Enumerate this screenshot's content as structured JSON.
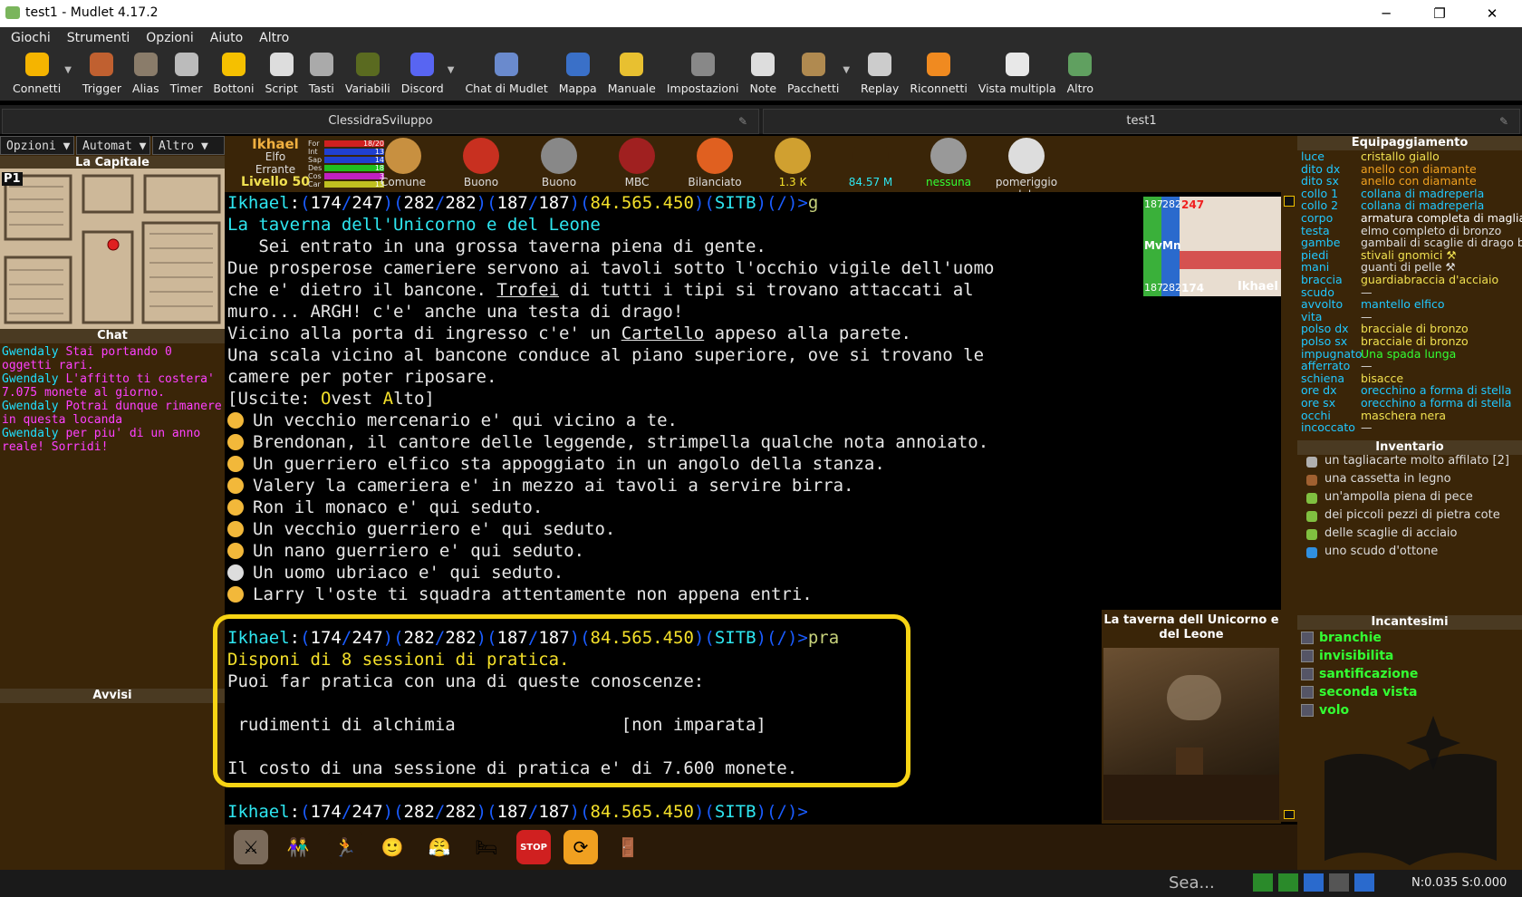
{
  "window": {
    "title": "test1 - Mudlet 4.17.2",
    "min": "─",
    "max": "❐",
    "close": "✕"
  },
  "menu": [
    "Giochi",
    "Strumenti",
    "Opzioni",
    "Aiuto",
    "Altro"
  ],
  "toolbar": [
    {
      "label": "Connetti",
      "icon": "connect-icon",
      "color": "#f5b400",
      "drop": true
    },
    {
      "label": "Trigger",
      "icon": "trigger-icon",
      "color": "#c06030"
    },
    {
      "label": "Alias",
      "icon": "alias-icon",
      "color": "#8a7c6a"
    },
    {
      "label": "Timer",
      "icon": "timer-icon",
      "color": "#bbbbbb"
    },
    {
      "label": "Bottoni",
      "icon": "star-icon",
      "color": "#f5c000"
    },
    {
      "label": "Script",
      "icon": "script-icon",
      "color": "#dddddd"
    },
    {
      "label": "Tasti",
      "icon": "keys-icon",
      "color": "#aaaaaa"
    },
    {
      "label": "Variabili",
      "icon": "variables-icon",
      "color": "#5a6a20"
    },
    {
      "label": "Discord",
      "icon": "discord-icon",
      "color": "#5865f2",
      "drop": true
    },
    {
      "label": "Chat di Mudlet",
      "icon": "chat-icon",
      "color": "#6a8acd"
    },
    {
      "label": "Mappa",
      "icon": "globe-icon",
      "color": "#3a70c8"
    },
    {
      "label": "Manuale",
      "icon": "bulb-icon",
      "color": "#e8c030"
    },
    {
      "label": "Impostazioni",
      "icon": "wrench-icon",
      "color": "#888888"
    },
    {
      "label": "Note",
      "icon": "note-icon",
      "color": "#dddddd"
    },
    {
      "label": "Pacchetti",
      "icon": "package-icon",
      "color": "#b08a50",
      "drop": true
    },
    {
      "label": "Replay",
      "icon": "replay-icon",
      "color": "#cccccc"
    },
    {
      "label": "Riconnetti",
      "icon": "reconnect-icon",
      "color": "#f08a20"
    },
    {
      "label": "Vista multipla",
      "icon": "multiview-icon",
      "color": "#e8e8e8"
    },
    {
      "label": "Altro",
      "icon": "more-icon",
      "color": "#60a060"
    }
  ],
  "tabs": [
    {
      "label": "ClessidraSviluppo",
      "x": "✎"
    },
    {
      "label": "test1",
      "x": "✎"
    }
  ],
  "left": {
    "combos": [
      "Opzioni ▼",
      "Automat ▼",
      "Altro ▼"
    ],
    "map_title": "La Capitale",
    "map_label": "P1",
    "chat_title": "Chat",
    "avvisi_title": "Avvisi",
    "chat": [
      {
        "name": "Gwendaly",
        "text": "Stai portando 0 oggetti rari."
      },
      {
        "name": "Gwendaly",
        "text": "L'affitto ti costera' 7.075 monete al giorno."
      },
      {
        "name": "Gwendaly",
        "text": "Potrai dunque rimanere in questa locanda"
      },
      {
        "name": "Gwendaly",
        "text": "per piu' di un anno reale! Sorridi!"
      }
    ]
  },
  "status": {
    "name": "Ikhael",
    "race": "Elfo",
    "class": "Errante",
    "level": "Livello 50",
    "bars": [
      {
        "l": "For",
        "v": "18/20",
        "c": "#d02020"
      },
      {
        "l": "Int",
        "v": "13",
        "c": "#2040d0"
      },
      {
        "l": "Sap",
        "v": "14",
        "c": "#2040d0"
      },
      {
        "l": "Des",
        "v": "18",
        "c": "#20c020"
      },
      {
        "l": "Cos",
        "v": "3",
        "c": "#c020c0"
      },
      {
        "l": "Car",
        "v": "13",
        "c": "#c0c020"
      }
    ],
    "items": [
      {
        "label": "Comune",
        "icon": "face-icon",
        "c": "#c89040",
        "lc": "#ddd"
      },
      {
        "label": "Buono",
        "icon": "target-icon",
        "c": "#c83020",
        "lc": "#ddd"
      },
      {
        "label": "Buono",
        "icon": "swords-icon",
        "c": "#888",
        "lc": "#ddd"
      },
      {
        "label": "MBC",
        "icon": "shield-icon",
        "c": "#a02020",
        "lc": "#ddd"
      },
      {
        "label": "Bilanciato",
        "icon": "mood-icon",
        "c": "#e06020",
        "lc": "#ddd"
      },
      {
        "label": "1.3 K",
        "icon": "money-icon",
        "c": "#d0a030",
        "lc": "#f4e02a"
      },
      {
        "label": "84.57 M",
        "icon": "stars-icon",
        "c": "#3a2508",
        "lc": "#2ee6f0"
      },
      {
        "label": "nessuna",
        "icon": "castle-icon",
        "c": "#999",
        "lc": "#3f3"
      },
      {
        "label": "pomeriggio del :",
        "icon": "weather-icon",
        "c": "#dddddd",
        "lc": "#ddd"
      }
    ]
  },
  "prompt": {
    "n": "Ikhael",
    "a": "174",
    "b": "247",
    "c": "282",
    "d": "282",
    "e": "187",
    "f": "187",
    "g": "84.565.450",
    "h": "SITB",
    "i": "/"
  },
  "main": {
    "cmd1": "g",
    "room": "La taverna dell'Unicorno e del Leone",
    "desc": [
      "   Sei entrato in una grossa taverna piena di gente.",
      "Due prosperose cameriere servono ai tavoli sotto l'occhio vigile dell'uomo"
    ],
    "d3a": "che e' dietro il bancone. ",
    "d3b": "Trofei",
    "d3c": " di tutti i tipi si trovano attaccati al",
    "d4": "muro... ARGH! c'e' anche una testa di drago!",
    "d5a": "Vicino alla porta di ingresso c'e' un ",
    "d5b": "Cartello",
    "d5c": " appeso alla parete.",
    "d6": "Una scala vicino al bancone conduce al piano superiore, ove si trovano le",
    "d7": "camere per poter riposare.",
    "exits_pre": "[Uscite: ",
    "ex1a": "O",
    "ex1b": "vest ",
    "ex2a": "A",
    "ex2b": "lto",
    "exits_post": "]",
    "npcs": [
      "Un vecchio mercenario e' qui vicino a te.",
      "Brendonan, il cantore delle leggende, strimpella qualche nota annoiato.",
      "Un guerriero elfico sta appoggiato in un angolo della stanza.",
      "Valery la cameriera e' in mezzo ai tavoli a servire birra.",
      "Ron il monaco e' qui seduto.",
      "Un vecchio guerriero e' qui seduto.",
      "Un nano guerriero e' qui seduto.",
      "Un uomo ubriaco e' qui seduto.",
      "Larry l'oste ti squadra attentamente non appena entri."
    ],
    "cmd2": "pra",
    "prac1": "Disponi di 8 sessioni di pratica.",
    "prac2": "Puoi far pratica con una di queste conoscenze:",
    "prac3": " rudimenti di alchimia                [non imparata]",
    "prac4": "Il costo di una sessione di pratica e' di 7.600 monete."
  },
  "portrait": {
    "mv": "Mv",
    "mn": "Mn",
    "v1": "187",
    "v2": "282",
    "v3": "247",
    "v4": "187",
    "v5": "282",
    "v6": "174",
    "name": "Ikhael"
  },
  "room_panel": {
    "title": "La taverna dell Unicorno e del Leone"
  },
  "actions": [
    {
      "icon": "swords-icon",
      "g": "⚔",
      "c": "#7a6a5a"
    },
    {
      "icon": "group-icon",
      "g": "👫",
      "c": "#2a1a08"
    },
    {
      "icon": "run-icon",
      "g": "🏃",
      "c": "#2a1a08"
    },
    {
      "icon": "smile-icon",
      "g": "🙂",
      "c": "#2a1a08"
    },
    {
      "icon": "angry-icon",
      "g": "😤",
      "c": "#2a1a08"
    },
    {
      "icon": "bed-icon",
      "g": "🛏",
      "c": "#2a1a08"
    },
    {
      "icon": "stop-icon",
      "g": "STOP",
      "c": "#d02020"
    },
    {
      "icon": "refresh-icon",
      "g": "⟳",
      "c": "#f0a020"
    },
    {
      "icon": "door-icon",
      "g": "🚪",
      "c": "#2a1a08"
    }
  ],
  "right": {
    "eq_title": "Equipaggiamento",
    "eq": [
      [
        "luce",
        "cristallo giallo",
        "#f0e050"
      ],
      [
        "dito dx",
        "anello con diamante",
        "#f0a020"
      ],
      [
        "dito sx",
        "anello con diamante",
        "#f0a020"
      ],
      [
        "collo 1",
        "collana di madreperla",
        "#20c8ff"
      ],
      [
        "collo 2",
        "collana di madreperla",
        "#20c8ff"
      ],
      [
        "corpo",
        "armatura completa di maglia",
        "#fff"
      ],
      [
        "testa",
        "elmo completo di bronzo",
        "#ddd"
      ],
      [
        "gambe",
        "gambali di scaglie di drago b",
        "#ddd"
      ],
      [
        "piedi",
        "stivali gnomici ⚒",
        "#f0e050"
      ],
      [
        "mani",
        "guanti di pelle ⚒",
        "#ddd"
      ],
      [
        "braccia",
        "guardiabraccia d'acciaio",
        "#f0e050"
      ],
      [
        "scudo",
        "—",
        "#ddd"
      ],
      [
        "avvolto",
        "mantello elfico",
        "#20c8ff"
      ],
      [
        "vita",
        "—",
        "#ddd"
      ],
      [
        "polso dx",
        "bracciale di bronzo",
        "#f0e050"
      ],
      [
        "polso sx",
        "bracciale di bronzo",
        "#f0e050"
      ],
      [
        "impugnato",
        "Una spada lunga",
        "#3f3"
      ],
      [
        "afferrato",
        "—",
        "#ddd"
      ],
      [
        "schiena",
        "bisacce",
        "#f0e050"
      ],
      [
        "ore dx",
        "orecchino a forma di stella",
        "#20c8ff"
      ],
      [
        "ore sx",
        "orecchino a forma di stella",
        "#20c8ff"
      ],
      [
        "occhi",
        "maschera nera",
        "#f0e050"
      ],
      [
        "incoccato",
        "—",
        "#ddd"
      ]
    ],
    "inv_title": "Inventario",
    "inv": [
      [
        "un tagliacarte molto affilato [2]",
        "#b0b0b0"
      ],
      [
        "una cassetta in legno",
        "#a06030"
      ],
      [
        "un'ampolla piena di pece",
        "#80c040"
      ],
      [
        "dei piccoli pezzi di pietra cote",
        "#80c040"
      ],
      [
        "delle scaglie di acciaio",
        "#80c040"
      ],
      [
        "uno scudo d'ottone",
        "#3090e0"
      ]
    ],
    "spells_title": "Incantesimi",
    "spells": [
      "branchie",
      "invisibilita",
      "santificazione",
      "seconda vista",
      "volo"
    ]
  },
  "taskbar": {
    "search": "Sea...",
    "status": "N:0.035 S:0.000"
  }
}
